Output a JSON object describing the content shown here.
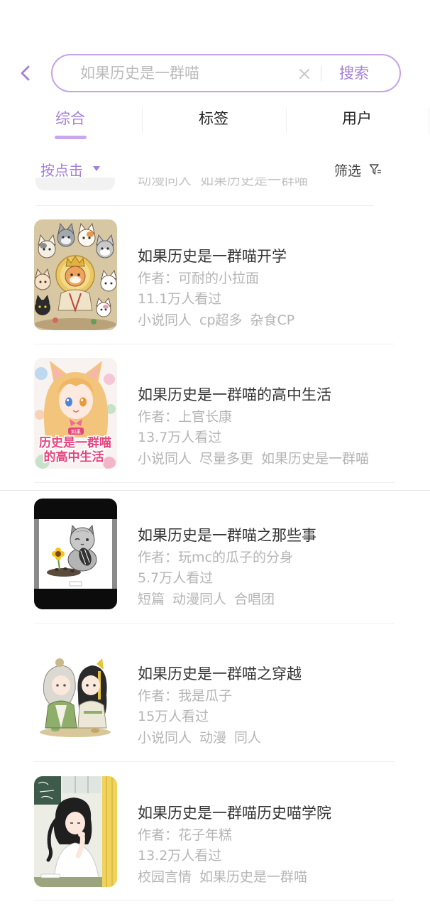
{
  "colors": {
    "accent": "#a47fd8",
    "search_border": "#c4a3e8",
    "tab_underline": "#c9a7ec",
    "title_text": "#333333",
    "meta_text": "#b5b5b5"
  },
  "header": {
    "back_icon": "chevron-left-icon",
    "search": {
      "placeholder": "如果历史是一群喵",
      "clear_icon": "close-icon",
      "submit_label": "搜索"
    }
  },
  "tabs": [
    {
      "label": "综合",
      "active": true
    },
    {
      "label": "标签",
      "active": false
    },
    {
      "label": "用户",
      "active": false
    }
  ],
  "filter_bar": {
    "sort_label": "按点击",
    "sort_icon": "caret-down-icon",
    "filter_label": "筛选",
    "filter_icon": "funnel-icon"
  },
  "partial_result": {
    "tags": [
      "动漫同人",
      "如果历史是一群喵"
    ]
  },
  "results": [
    {
      "title": "如果历史是一群喵开学",
      "author": "作者：可耐的小拉面",
      "views": "11.1万人看过",
      "tags": [
        "小说同人",
        "cp超多",
        "杂食CP"
      ]
    },
    {
      "title": "如果历史是一群喵的高中生活",
      "author": "作者：上官长康",
      "views": "13.7万人看过",
      "tags": [
        "小说同人",
        "尽量多更",
        "如果历史是一群喵"
      ],
      "cover_text": [
        "如果",
        "历史是一群喵",
        "的高中生活"
      ]
    },
    {
      "title": "如果历史是一群喵之那些事",
      "author": "作者：玩mc的瓜子的分身",
      "views": "5.7万人看过",
      "tags": [
        "短篇",
        "动漫同人",
        "合唱团"
      ]
    },
    {
      "title": "如果历史是一群喵之穿越",
      "author": "作者：我是瓜子",
      "views": "15万人看过",
      "tags": [
        "小说同人",
        "动漫",
        "同人"
      ]
    },
    {
      "title": "如果历史是一群喵历史喵学院",
      "author": "作者：花子年糕",
      "views": "13.2万人看过",
      "tags": [
        "校园言情",
        "如果历史是一群喵"
      ]
    }
  ]
}
